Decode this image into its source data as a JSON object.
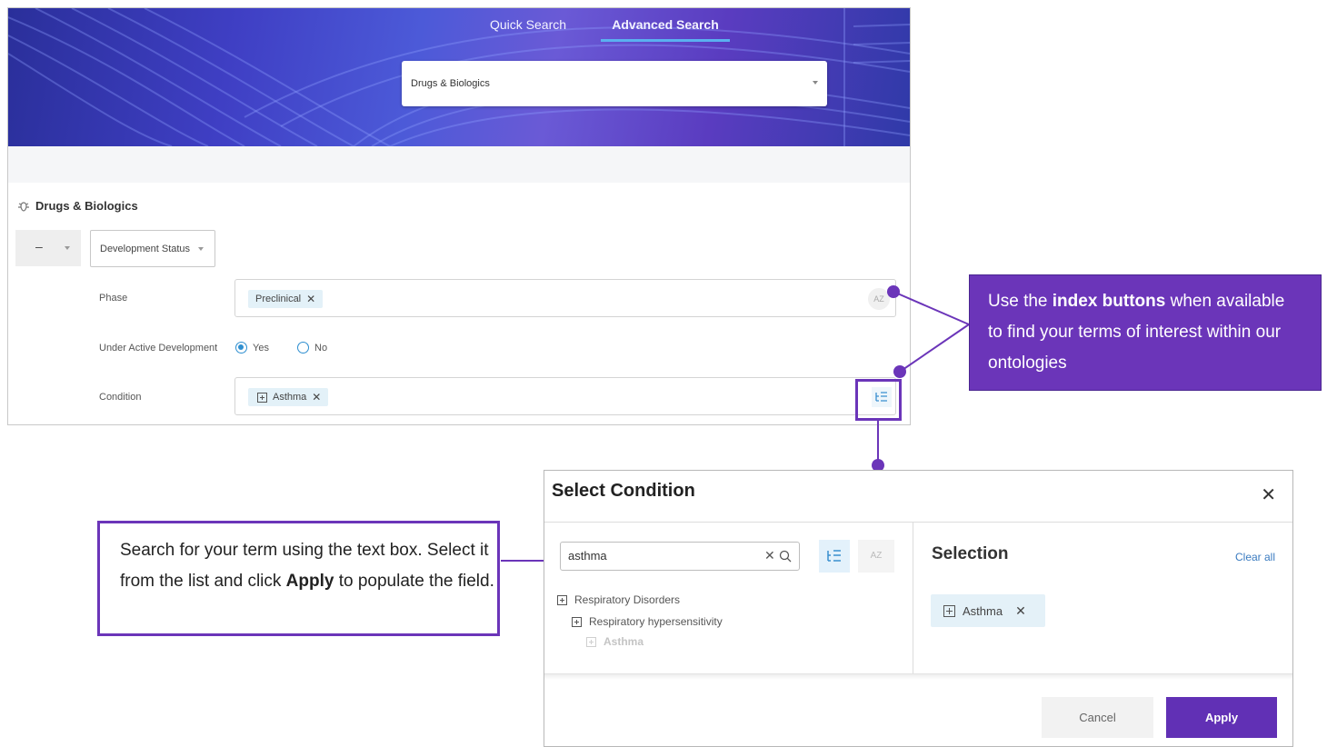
{
  "header": {
    "tabs": [
      {
        "label": "Quick Search",
        "active": false
      },
      {
        "label": "Advanced Search",
        "active": true
      }
    ],
    "database_select": {
      "value": "Drugs & Biologics"
    }
  },
  "builder": {
    "section_title": "Drugs & Biologics",
    "operator_value": "–",
    "field_select_value": "Development Status",
    "rows": [
      {
        "label": "Phase",
        "chip": "Preclinical",
        "button_text": "AZ",
        "button_icon": "az-index-icon"
      },
      {
        "label": "Under Active Development",
        "options": [
          {
            "label": "Yes",
            "selected": true
          },
          {
            "label": "No",
            "selected": false
          }
        ]
      },
      {
        "label": "Condition",
        "chip": "Asthma",
        "button_icon": "tree-index-icon"
      }
    ]
  },
  "annotations": {
    "index_callout": {
      "prefix": "Use the ",
      "bold": "index buttons",
      "suffix": " when available to find your terms of interest within our ontologies"
    },
    "search_note": {
      "text": "Search for your term using the text box. Select it from the list and click ",
      "bold": "Apply",
      "suffix": " to populate the field."
    },
    "accent_color": "#6b35b9"
  },
  "dialog": {
    "title": "Select Condition",
    "search_value": "asthma",
    "az_label": "AZ",
    "tree": [
      {
        "label": "Respiratory Disorders",
        "level": 0,
        "dimmed": false
      },
      {
        "label": "Respiratory hypersensitivity",
        "level": 1,
        "dimmed": false
      },
      {
        "label": "Asthma",
        "level": 2,
        "dimmed": true
      }
    ],
    "selection_title": "Selection",
    "clear_all": "Clear all",
    "selected_chip": "Asthma",
    "cancel_label": "Cancel",
    "apply_label": "Apply"
  }
}
